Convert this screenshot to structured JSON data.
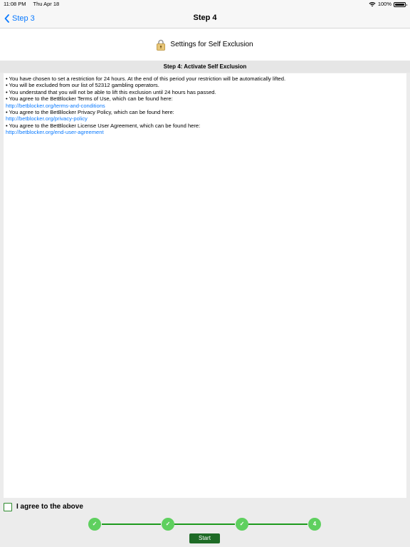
{
  "status_bar": {
    "time": "11:08 PM",
    "date": "Thu Apr 18",
    "battery": "100%"
  },
  "nav": {
    "back_label": "Step 3",
    "title": "Step 4"
  },
  "header": {
    "title": "Settings for Self Exclusion",
    "icon": "lock-icon"
  },
  "section_title": "Step 4: Activate Self Exclusion",
  "terms": {
    "line1": "• You have chosen to set a restriction for 24 hours. At the end of this period your restriction will be automatically lifted.",
    "line2": "• You will be excluded from our list of 52312 gambling operators.",
    "line3": "• You understand that you will not be able to lift this exclusion until 24 hours has passed.",
    "line4": "• You agree to the BetBlocker Terms of Use, which can be found here:",
    "link1": "http://betblocker.org/terms-and-conditions",
    "line5": "• You agree to the BetBlocker Privacy Policy, which can be found here:",
    "link2": "http://betblocker.org/privacy-policy",
    "line6": "• You agree to the BetBlocker License User Agreement, which can be found here:",
    "link3": "http://betblocker.org/end-user-agreement"
  },
  "agree": {
    "label": "I agree to the above",
    "checked": false
  },
  "progress": {
    "steps": [
      "✓",
      "✓",
      "✓",
      "4"
    ],
    "current_step": 4
  },
  "start_button": "Start",
  "colors": {
    "link": "#0a7aff",
    "step_green": "#5fd05f",
    "line_green": "#1e9a1e",
    "button_green": "#1e6b26"
  }
}
